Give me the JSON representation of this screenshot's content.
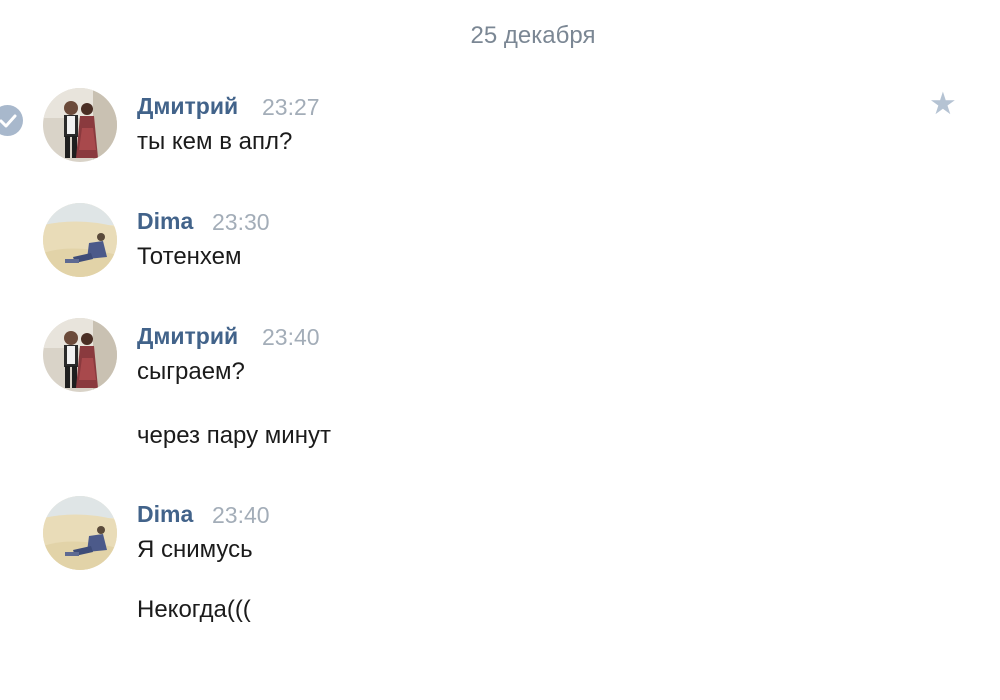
{
  "date_separator": "25 декабря",
  "messages": [
    {
      "author": "Дмитрий",
      "time": "23:27",
      "avatar": "couple-photo",
      "texts": [
        "ты кем в апл?"
      ]
    },
    {
      "author": "Dima",
      "time": "23:30",
      "avatar": "beach-photo",
      "texts": [
        "Тотенхем"
      ]
    },
    {
      "author": "Дмитрий",
      "time": "23:40",
      "avatar": "couple-photo",
      "texts": [
        "сыграем?",
        "через пару минут"
      ]
    },
    {
      "author": "Dima",
      "time": "23:40",
      "avatar": "beach-photo",
      "texts": [
        "Я снимусь",
        "Некогда((("
      ]
    }
  ],
  "icons": {
    "selected": "check-icon",
    "favorite": "star-icon"
  },
  "colors": {
    "author": "#42638a",
    "time": "#a3adb8",
    "text": "#1b1b1b",
    "date": "#7b8794",
    "check_bg": "#a8b8cc",
    "star": "#b5c3d3"
  }
}
